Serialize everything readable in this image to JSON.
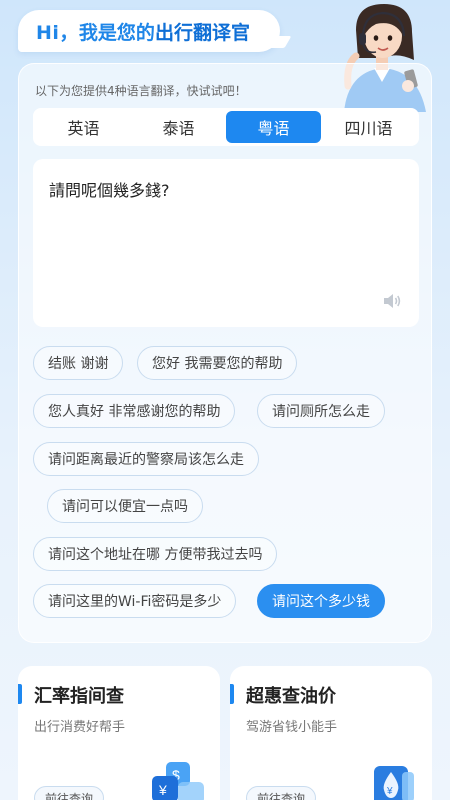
{
  "header": {
    "greeting": "Hi，",
    "title_pre": "我是您的",
    "title_hl": "出行翻译官"
  },
  "translator": {
    "intro": "以下为您提供4种语言翻译，快试试吧！",
    "tabs": [
      {
        "label": "英语",
        "active": false
      },
      {
        "label": "泰语",
        "active": false
      },
      {
        "label": "粤语",
        "active": true
      },
      {
        "label": "四川语",
        "active": false
      }
    ],
    "text": "請問呢個幾多錢?",
    "phrases": [
      "结账 谢谢",
      "您好 我需要您的帮助",
      "您人真好 非常感谢您的帮助",
      "请问厕所怎么走",
      "请问距离最近的警察局该怎么走",
      "请问可以便宜一点吗",
      "请问这个地址在哪 方便带我过去吗",
      "请问这里的Wi-Fi密码是多少",
      "请问这个多少钱"
    ],
    "selected_phrase": "请问这个多少钱"
  },
  "cards": [
    {
      "title": "汇率指间查",
      "subtitle": "出行消费好帮手",
      "button": "前往查询",
      "icon": "currency-exchange-icon"
    },
    {
      "title": "超惠查油价",
      "subtitle": "驾游省钱小能手",
      "button": "前往查询",
      "icon": "fuel-price-icon"
    }
  ],
  "colors": {
    "accent": "#1e88f0",
    "title": "#1f86e8"
  }
}
